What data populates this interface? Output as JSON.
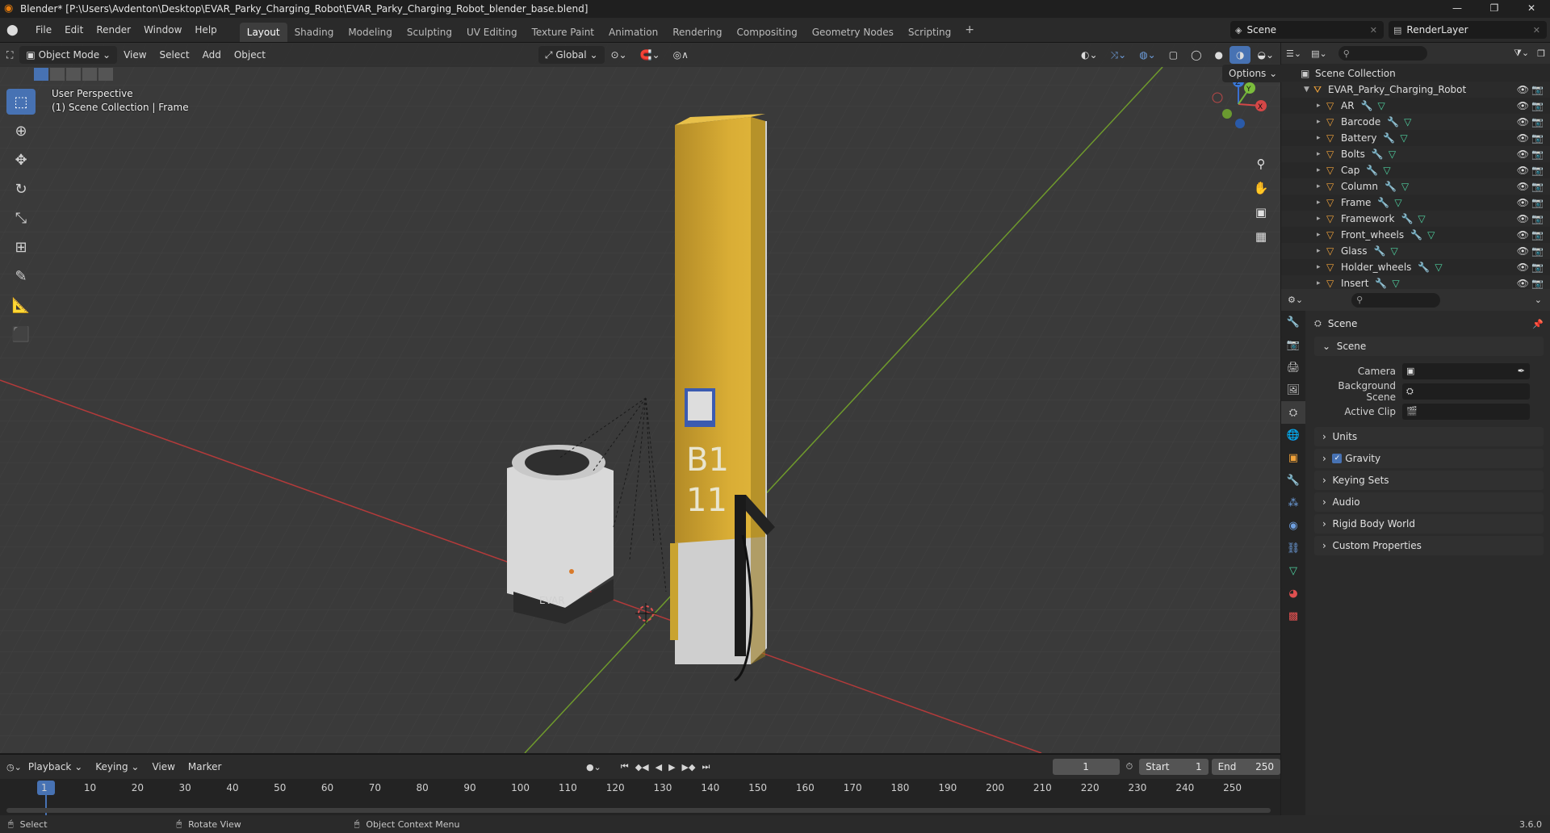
{
  "window": {
    "title": "Blender* [P:\\Users\\Avdenton\\Desktop\\EVAR_Parky_Charging_Robot\\EVAR_Parky_Charging_Robot_blender_base.blend]",
    "controls": [
      "—",
      "❐",
      "✕"
    ]
  },
  "menu": [
    "File",
    "Edit",
    "Render",
    "Window",
    "Help"
  ],
  "workspaces": [
    "Layout",
    "Shading",
    "Modeling",
    "Sculpting",
    "UV Editing",
    "Texture Paint",
    "Animation",
    "Rendering",
    "Compositing",
    "Geometry Nodes",
    "Scripting"
  ],
  "active_workspace": "Layout",
  "workspace_add": "+",
  "scene_selector": "Scene",
  "view_layer": "RenderLayer",
  "viewport": {
    "mode": "Object Mode",
    "menus": [
      "View",
      "Select",
      "Add",
      "Object"
    ],
    "transform_orientation": "Global",
    "options_label": "Options",
    "perspective_label": "User Perspective",
    "context_label": "(1) Scene Collection | Frame",
    "gizmo_axes": {
      "x": "X",
      "y": "Y",
      "z": "Z"
    },
    "column_label_line1": "B1",
    "column_label_line2": "11",
    "robot_brand": "EVAR"
  },
  "outliner": {
    "root": "Scene Collection",
    "collection": "EVAR_Parky_Charging_Robot",
    "items": [
      "AR",
      "Barcode",
      "Battery",
      "Bolts",
      "Cap",
      "Column",
      "Frame",
      "Framework",
      "Front_wheels",
      "Glass",
      "Holder_wheels",
      "Insert"
    ]
  },
  "properties": {
    "header": "Scene",
    "panel_scene": "Scene",
    "fields": [
      {
        "label": "Camera",
        "value": ""
      },
      {
        "label": "Background Scene",
        "value": ""
      },
      {
        "label": "Active Clip",
        "value": ""
      }
    ],
    "panels": [
      "Units",
      "Gravity",
      "Keying Sets",
      "Audio",
      "Rigid Body World",
      "Custom Properties"
    ],
    "gravity_checked": true
  },
  "timeline": {
    "menus": [
      "Playback",
      "Keying",
      "View",
      "Marker"
    ],
    "current_frame": "1",
    "start_label": "Start",
    "start": "1",
    "end_label": "End",
    "end": "250",
    "ruler_ticks": [
      "1",
      "10",
      "20",
      "30",
      "40",
      "50",
      "60",
      "70",
      "80",
      "90",
      "100",
      "110",
      "120",
      "130",
      "140",
      "150",
      "160",
      "170",
      "180",
      "190",
      "200",
      "210",
      "220",
      "230",
      "240",
      "250"
    ]
  },
  "statusbar": {
    "hints": [
      "Select",
      "Rotate View",
      "Object Context Menu"
    ],
    "version": "3.6.0"
  },
  "colors": {
    "accent": "#4772b3",
    "active_frame": "#4772b3",
    "x_axis": "#c0393b",
    "y_axis": "#7ca72b",
    "object_icon": "#f0a23a",
    "column_yellow": "#d9ad35"
  }
}
